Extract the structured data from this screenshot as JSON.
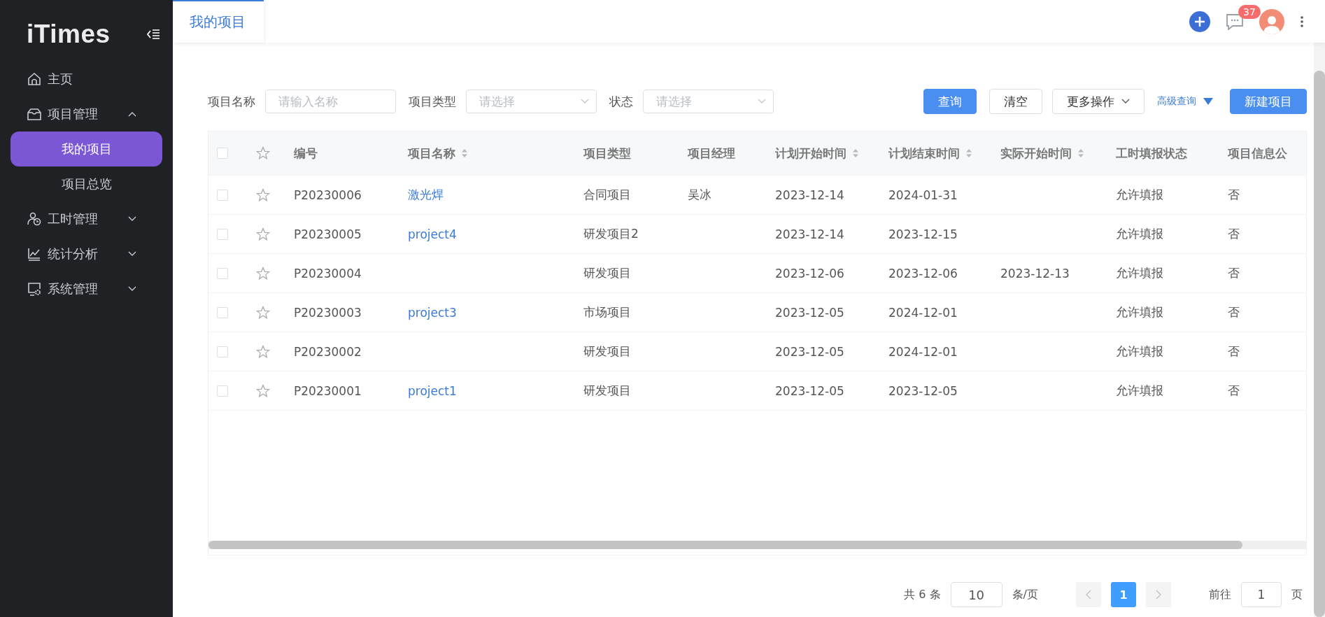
{
  "brand": "iTimes",
  "sidebar": {
    "items": [
      {
        "label": "主页",
        "kind": "link"
      },
      {
        "label": "项目管理",
        "kind": "group",
        "expanded": true,
        "children": [
          {
            "label": "我的项目",
            "selected": true
          },
          {
            "label": "项目总览",
            "selected": false
          }
        ]
      },
      {
        "label": "工时管理",
        "kind": "group",
        "expanded": false
      },
      {
        "label": "统计分析",
        "kind": "group",
        "expanded": false
      },
      {
        "label": "系统管理",
        "kind": "group",
        "expanded": false
      }
    ]
  },
  "header": {
    "tabs": [
      {
        "label": "我的项目",
        "selected": true
      }
    ],
    "message_count": "37"
  },
  "filters": [
    {
      "label": "项目名称",
      "kind": "input",
      "placeholder": "请输入名称"
    },
    {
      "label": "项目类型",
      "kind": "select",
      "placeholder": "请选择"
    },
    {
      "label": "状态",
      "kind": "select",
      "placeholder": "请选择"
    }
  ],
  "actions": [
    {
      "label": "查询",
      "kind": "primary"
    },
    {
      "label": "清空",
      "kind": "plain"
    },
    {
      "label": "更多操作",
      "kind": "dropdown"
    },
    {
      "label": "高级查询",
      "kind": "link"
    },
    {
      "label": "新建项目",
      "kind": "primary"
    }
  ],
  "table": {
    "select_all_checked": false,
    "columns": [
      {
        "label": "编号",
        "sortable": false,
        "kind": "text"
      },
      {
        "label": "项目名称",
        "sortable": true,
        "kind": "link"
      },
      {
        "label": "项目类型",
        "sortable": false,
        "kind": "text"
      },
      {
        "label": "项目经理",
        "sortable": false,
        "kind": "text"
      },
      {
        "label": "计划开始时间",
        "sortable": true,
        "kind": "text"
      },
      {
        "label": "计划结束时间",
        "sortable": true,
        "kind": "text"
      },
      {
        "label": "实际开始时间",
        "sortable": true,
        "kind": "text"
      },
      {
        "label": "工时填报状态",
        "sortable": false,
        "kind": "text"
      },
      {
        "label": "项目信息公",
        "sortable": false,
        "kind": "text"
      }
    ],
    "rows": [
      {
        "checked": false,
        "starred": false,
        "cells": [
          "P20230006",
          "激光焊",
          "合同项目",
          "吴冰",
          "2023-12-14",
          "2024-01-31",
          null,
          "允许填报",
          "否"
        ]
      },
      {
        "checked": false,
        "starred": false,
        "cells": [
          "P20230005",
          "project4",
          "研发项目2",
          null,
          "2023-12-14",
          "2023-12-15",
          null,
          "允许填报",
          "否"
        ]
      },
      {
        "checked": false,
        "starred": false,
        "cells": [
          "P20230004",
          null,
          "研发项目",
          null,
          "2023-12-06",
          "2023-12-06",
          "2023-12-13",
          "允许填报",
          "否"
        ]
      },
      {
        "checked": false,
        "starred": false,
        "cells": [
          "P20230003",
          "project3",
          "市场项目",
          null,
          "2023-12-05",
          "2024-12-01",
          null,
          "允许填报",
          "否"
        ]
      },
      {
        "checked": false,
        "starred": false,
        "cells": [
          "P20230002",
          null,
          "研发项目",
          null,
          "2023-12-05",
          "2024-12-01",
          null,
          "允许填报",
          "否"
        ]
      },
      {
        "checked": false,
        "starred": false,
        "cells": [
          "P20230001",
          "project1",
          "研发项目",
          null,
          "2023-12-05",
          "2023-12-05",
          null,
          "允许填报",
          "否"
        ]
      }
    ]
  },
  "pagination": {
    "total": "共 6 条",
    "page_size": "10",
    "page_size_unit": "条/页",
    "pages": [
      {
        "label": "1",
        "selected": true
      }
    ],
    "goto_label": "前往",
    "goto_value": "1",
    "goto_unit": "页"
  }
}
